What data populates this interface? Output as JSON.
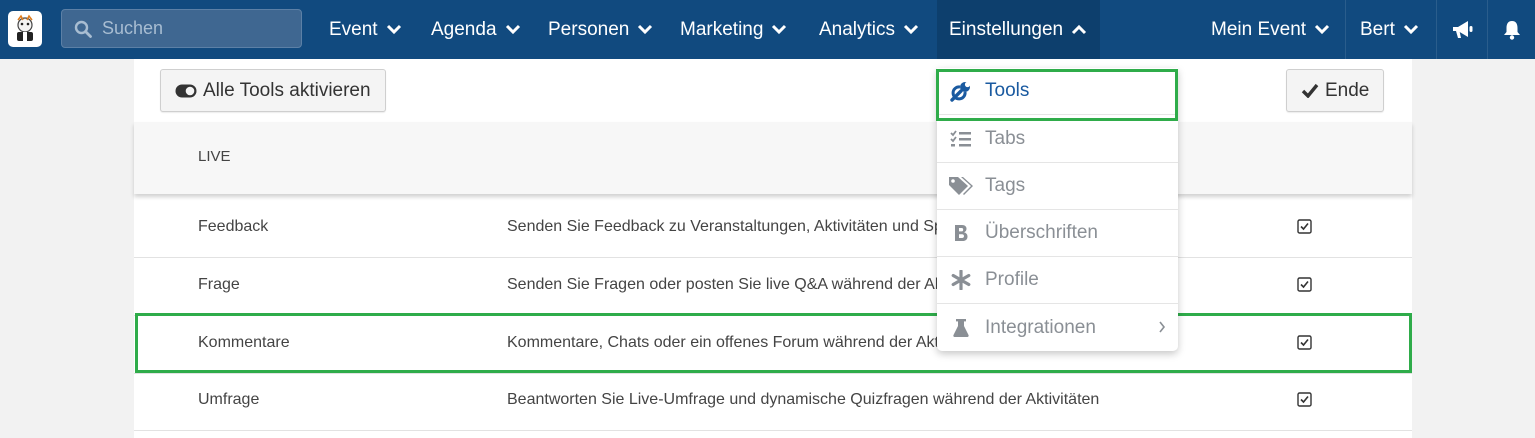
{
  "nav": {
    "search_placeholder": "Suchen",
    "items": [
      {
        "label": "Event"
      },
      {
        "label": "Agenda"
      },
      {
        "label": "Personen"
      },
      {
        "label": "Marketing"
      },
      {
        "label": "Analytics"
      },
      {
        "label": "Einstellungen"
      }
    ],
    "right": [
      {
        "label": "Mein Event"
      },
      {
        "label": "Bert"
      }
    ],
    "icons": [
      "megaphone-icon",
      "bell-icon"
    ]
  },
  "toolbar": {
    "toggle_all_label": "Alle Tools aktivieren",
    "end_label": "Ende"
  },
  "table": {
    "section_header": "LIVE",
    "rows": [
      {
        "name": "Feedback",
        "description": "Senden Sie Feedback zu Veranstaltungen, Aktivitäten und Spo",
        "enabled": true
      },
      {
        "name": "Frage",
        "description": "Senden Sie Fragen oder posten Sie live Q&A während der Akt",
        "enabled": true
      },
      {
        "name": "Kommentare",
        "description": "Kommentare, Chats oder ein offenes Forum während der Akti",
        "enabled": true
      },
      {
        "name": "Umfrage",
        "description": "Beantworten Sie Live-Umfrage und dynamische Quizfragen während der Aktivitäten",
        "enabled": true
      }
    ]
  },
  "dropdown": {
    "items": [
      {
        "label": "Tools",
        "icon": "wrench-icon",
        "active": true
      },
      {
        "label": "Tabs",
        "icon": "list-check-icon"
      },
      {
        "label": "Tags",
        "icon": "tags-icon"
      },
      {
        "label": "Überschriften",
        "icon": "bold-icon"
      },
      {
        "label": "Profile",
        "icon": "asterisk-icon"
      },
      {
        "label": "Integrationen",
        "icon": "flask-icon",
        "submenu": true
      }
    ]
  },
  "colors": {
    "nav_bg": "#114a7f",
    "highlight": "#2fac4a",
    "active_link": "#1a5aa0"
  }
}
